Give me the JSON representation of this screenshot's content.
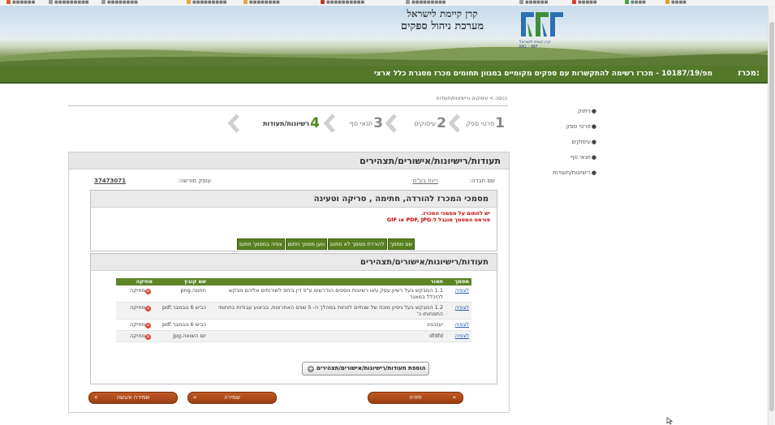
{
  "colors": {
    "brand_green": "#54782a",
    "table_green": "#5f8527",
    "button_orange": "#b04a1a",
    "warning_red": "#c00000",
    "link_blue": "#2a5db0"
  },
  "header": {
    "title_line1": "קרן קיימת לישראל",
    "title_line2": "מערכת ניהול ספקים",
    "logo_text": "קרן קימת לישראל KKL - JNF"
  },
  "tender_bar": {
    "label": "מכרז:",
    "text": "מפ/10187/19 - מכרז רשימה להתקשרות עם ספקים מקומיים במגוון תחומים מכרז מסגרת כלל ארצי"
  },
  "side_nav": {
    "items": [
      {
        "label": "ניתוק",
        "icon": "bullet-icon"
      },
      {
        "label": "פרטי ספק",
        "icon": "bullet-icon"
      },
      {
        "label": "עיסוקים",
        "icon": "bullet-icon"
      },
      {
        "label": "תנאי סף",
        "icon": "bullet-icon"
      },
      {
        "label": "רישיונות/תעודות",
        "icon": "bullet-icon"
      }
    ]
  },
  "breadcrumb": "כניסה > עיסוקים ורישיונות/תעודות",
  "wizard": {
    "steps": [
      {
        "num": "1",
        "label": "פרטי ספק"
      },
      {
        "num": "2",
        "label": "עיסוקים"
      },
      {
        "num": "3",
        "label": "תנאי סף"
      },
      {
        "num": "4",
        "label": "רשיונות/תעודות"
      }
    ],
    "active_step": 4
  },
  "panel": {
    "title": "תעודות/רישיונות/אישורים/תצהירים",
    "company_label": "שם חברה:",
    "company_value": "רינת בע\"מ",
    "dealer_label": "עוסק מורשה:",
    "dealer_value": "37473071"
  },
  "tender_docs": {
    "title": "מסמכי המכרז להורדה, חתימה , סריקה וטעינה",
    "warning_line1": "יש לחתום על מסמכי המכרז.",
    "warning_line2": "פורמט המסמך מוגבל ל-PDF, JPG או GIF",
    "tabs": [
      "שם מסמך",
      "להורדת מסמך לא חתום",
      "טען מסמך חתום",
      "צפיה במסמך חתום"
    ]
  },
  "certs": {
    "title": "תעודות/רישיונות/אישורים/תצהירים",
    "columns": {
      "doc": "מסמך",
      "desc": "תאור",
      "file": "שם קובץ",
      "delete": "מחיקה"
    },
    "rows": [
      {
        "doc": "לצפיה",
        "desc": "1.1  המבקש בעל רשיון עסק ו\\או רשיונות נוספים הנדרשים ע\"פ דין ביחס לשירותים אליהם מבקש להיכלל במאגר",
        "file": "חתונה.png",
        "delete": "מחיקה"
      },
      {
        "doc": "לצפיה",
        "desc": "1.2  המבקש בעל ניסיון מוכח של שנתיים לפחות במהלך ה- 5 שנים האחרונות, בביצוע עבודות בתחומי התמחותו כ'",
        "file": "כביש 6 נובמבר.pdf",
        "delete": "מחיקה"
      },
      {
        "doc": "לצפיה",
        "desc": "יעככגיכ",
        "file": "כביש 6 נובמבר.pdf",
        "delete": "מחיקה"
      },
      {
        "doc": "לצפיה",
        "desc": "dfdfd",
        "file": "יום השואה.jpg",
        "delete": "מחיקה"
      }
    ],
    "add_button": "הוספת תעודות/רישיונות/אישורים/תצהירים"
  },
  "footer_buttons": {
    "save_submit": "שמירה והגשה",
    "save": "שמירה",
    "back": "חזרה"
  }
}
